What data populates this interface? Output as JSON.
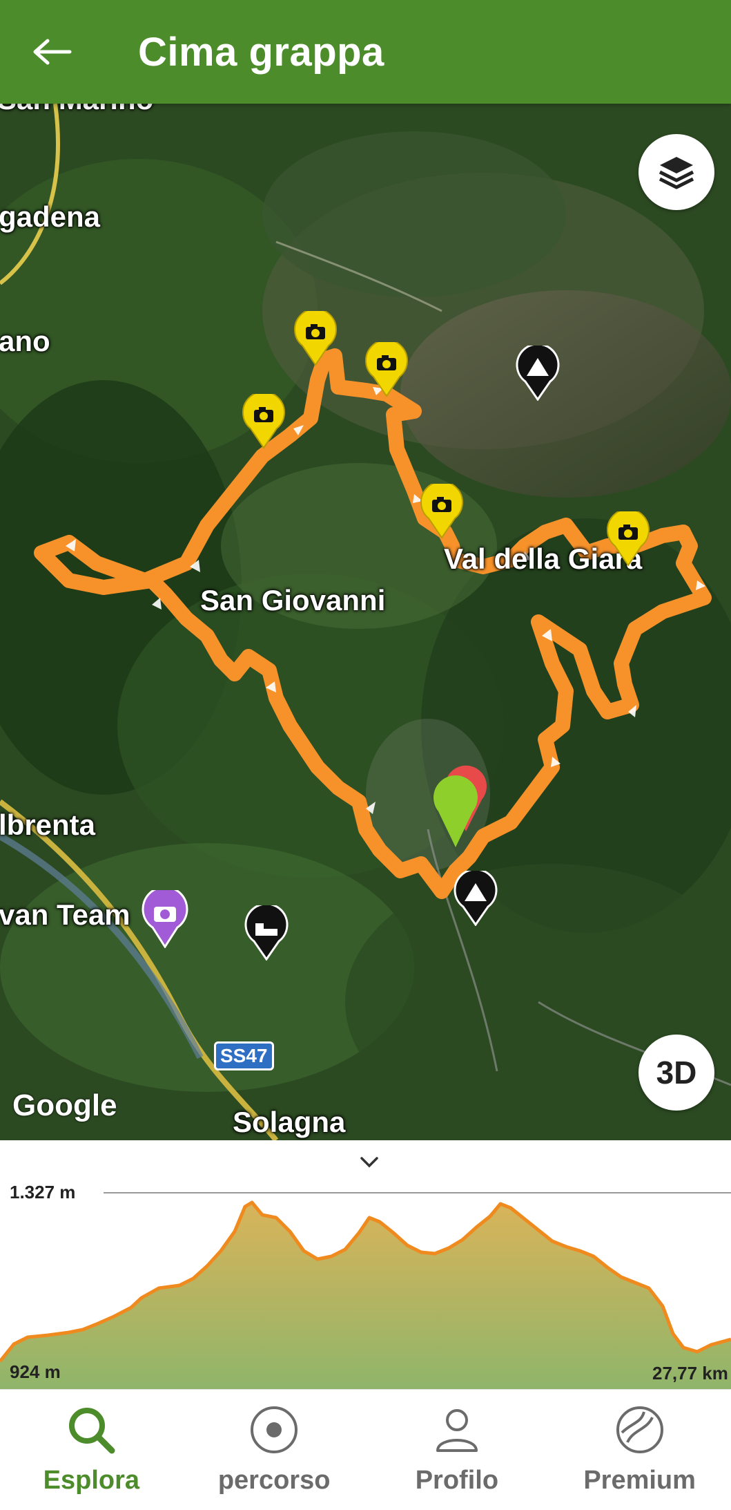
{
  "app_bar": {
    "title": "Cima grappa",
    "back_icon": "arrow-left-icon"
  },
  "map": {
    "labels": {
      "san_marino": "San Marino",
      "gadena": "gadena",
      "nano": "ano",
      "san_giovanni": "San Giovanni",
      "val_della_giara": "Val della Giara",
      "albrenta": "lbrenta",
      "van_team": "van Team",
      "solagna": "Solagna"
    },
    "road_badge": "SS47",
    "google_logo": "Google",
    "layers_icon": "layers-icon",
    "btn_3d": "3D",
    "route_color": "#f7922b"
  },
  "profile": {
    "max_elevation": "1.327 m",
    "min_elevation": "924 m",
    "distance": "27,77 km",
    "collapse_icon": "chevron-down-icon"
  },
  "nav": {
    "items": [
      {
        "label": "Esplora",
        "icon": "search-icon",
        "active": true
      },
      {
        "label": "percorso",
        "icon": "record-icon",
        "active": false
      },
      {
        "label": "Profilo",
        "icon": "person-icon",
        "active": false
      },
      {
        "label": "Premium",
        "icon": "premium-icon",
        "active": false
      }
    ]
  },
  "colors": {
    "primary": "#4c8c2b",
    "route": "#f7922b",
    "poi_yellow": "#f2d600"
  }
}
